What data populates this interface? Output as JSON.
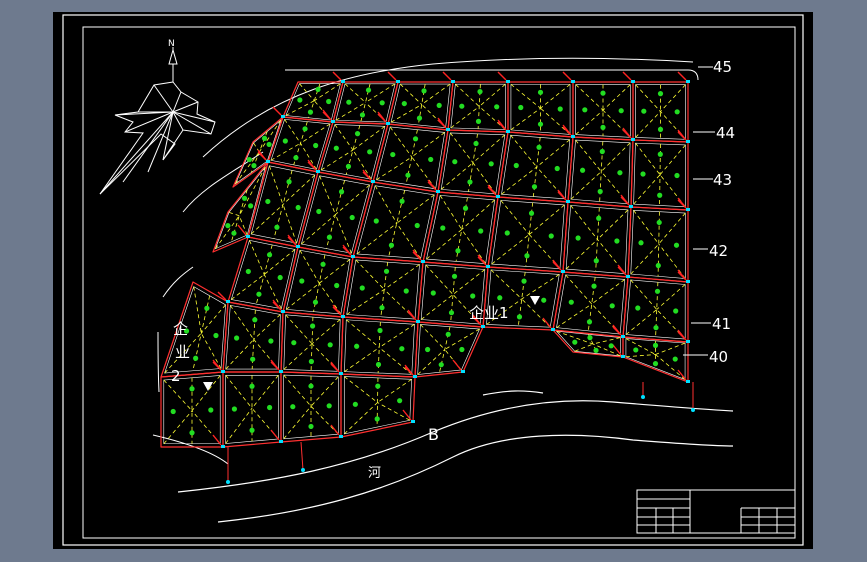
{
  "north_label": "N",
  "contour_labels": [
    "45",
    "44",
    "43",
    "42",
    "41",
    "40"
  ],
  "zone_labels": {
    "enterprise1": "企业1",
    "enterprise2_line1": "企",
    "enterprise2_line2": "业",
    "enterprise2_line3": "2"
  },
  "river_label": "河",
  "river_point": "B",
  "colors": {
    "background": "#000000",
    "frame": "#ffffff",
    "block_outline": "#ff3030",
    "road_edge": "#ffffff",
    "catchment_lines": "#ffff33",
    "sub_node_markers": "#22dd22",
    "flow_arrows": "#ff2222",
    "pipe_nodes": "#00e0ff"
  }
}
